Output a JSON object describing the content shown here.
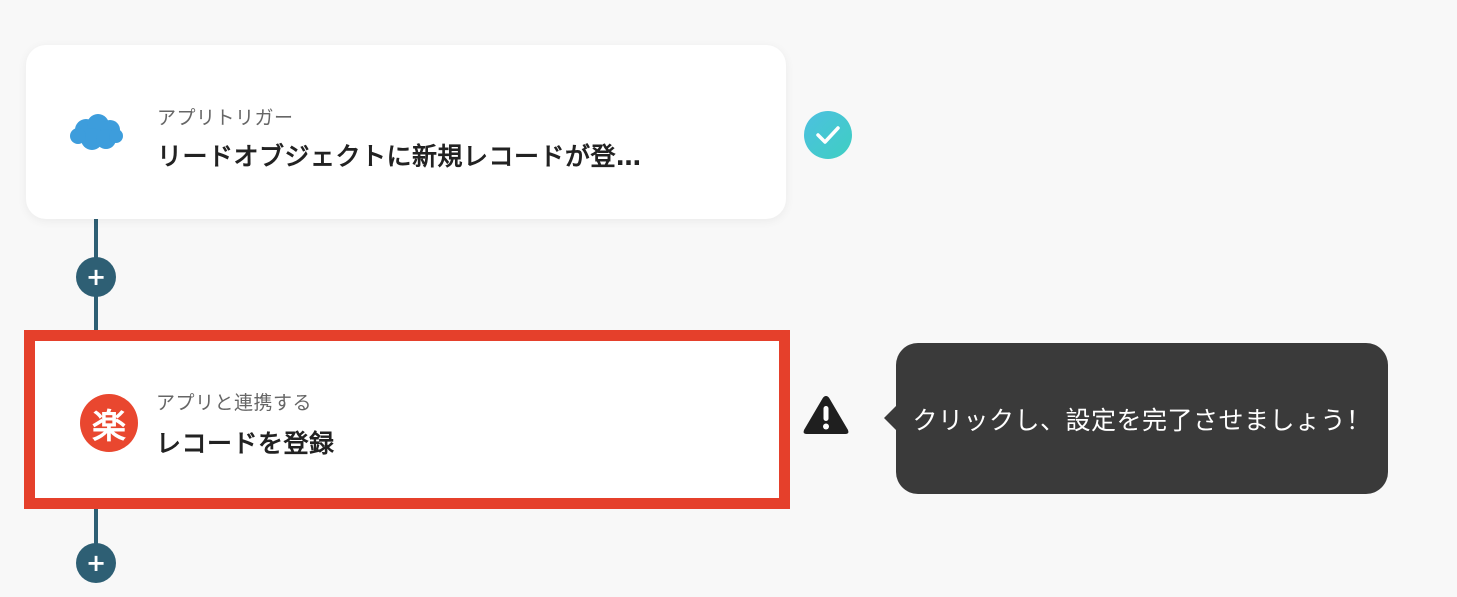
{
  "flow": {
    "trigger": {
      "app_icon": "salesforce-cloud-icon",
      "subtitle": "アプリトリガー",
      "title": "リードオブジェクトに新規レコードが登…",
      "status_icon": "check-icon",
      "status": "complete"
    },
    "add_step_label": "+",
    "action": {
      "app_icon": "rakuten-icon",
      "app_icon_text": "楽",
      "subtitle": "アプリと連携する",
      "title": "レコードを登録",
      "status_icon": "warning-icon",
      "status": "incomplete"
    },
    "tooltip": {
      "text": "クリックし、設定を完了させましょう！"
    }
  },
  "colors": {
    "background": "#f8f8f8",
    "connector": "#2e5f74",
    "highlight_border": "#e5402b",
    "check_gradient_start": "#4cc0e0",
    "check_gradient_end": "#3fcfc2",
    "tooltip_bg": "#3a3a3a",
    "salesforce_blue": "#3d9ddc",
    "rakuten_red": "#e9472f"
  }
}
